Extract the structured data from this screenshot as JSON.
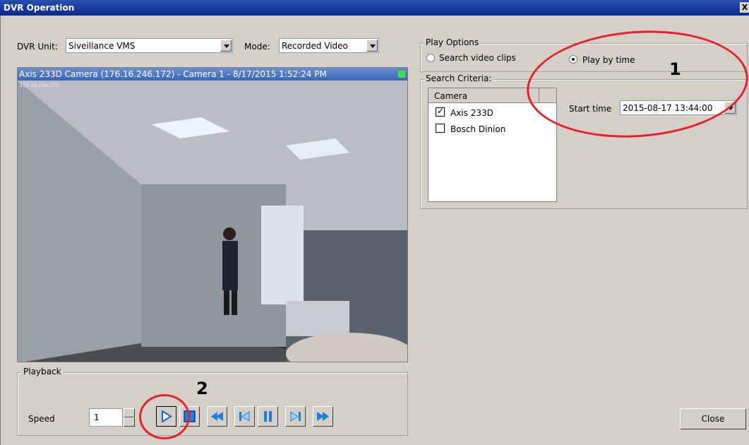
{
  "window": {
    "title": "DVR Operation",
    "close_glyph": "X"
  },
  "top": {
    "dvr_unit_label": "DVR Unit:",
    "dvr_unit_value": "Siveillance VMS",
    "mode_label": "Mode:",
    "mode_value": "Recorded Video"
  },
  "video": {
    "caption": "Axis 233D Camera (176.16.246.172) - Camera 1 - 8/17/2015 1:52:24 PM",
    "overlay_ip": "176.16.246.172",
    "status_color": "#3fe04a"
  },
  "play_options": {
    "title": "Play Options",
    "search_clips": "Search video clips",
    "play_by_time": "Play by time",
    "selected": "Play by time"
  },
  "search_criteria": {
    "title": "Search Criteria:",
    "column": "Camera",
    "cameras": [
      {
        "name": "Axis 233D",
        "checked": true
      },
      {
        "name": "Bosch Dinion",
        "checked": false
      }
    ],
    "start_time_label": "Start time",
    "start_time_value": "2015-08-17 13:44:00"
  },
  "playback": {
    "title": "Playback",
    "speed_label": "Speed",
    "speed_value": "1",
    "buttons": [
      "play-icon",
      "stop-icon",
      "rewind-icon",
      "step-back-icon",
      "pause-icon",
      "step-forward-icon",
      "fast-forward-icon"
    ]
  },
  "close_button": "Close",
  "annotations": {
    "one": "1",
    "two": "2",
    "color": "#e8202a"
  }
}
